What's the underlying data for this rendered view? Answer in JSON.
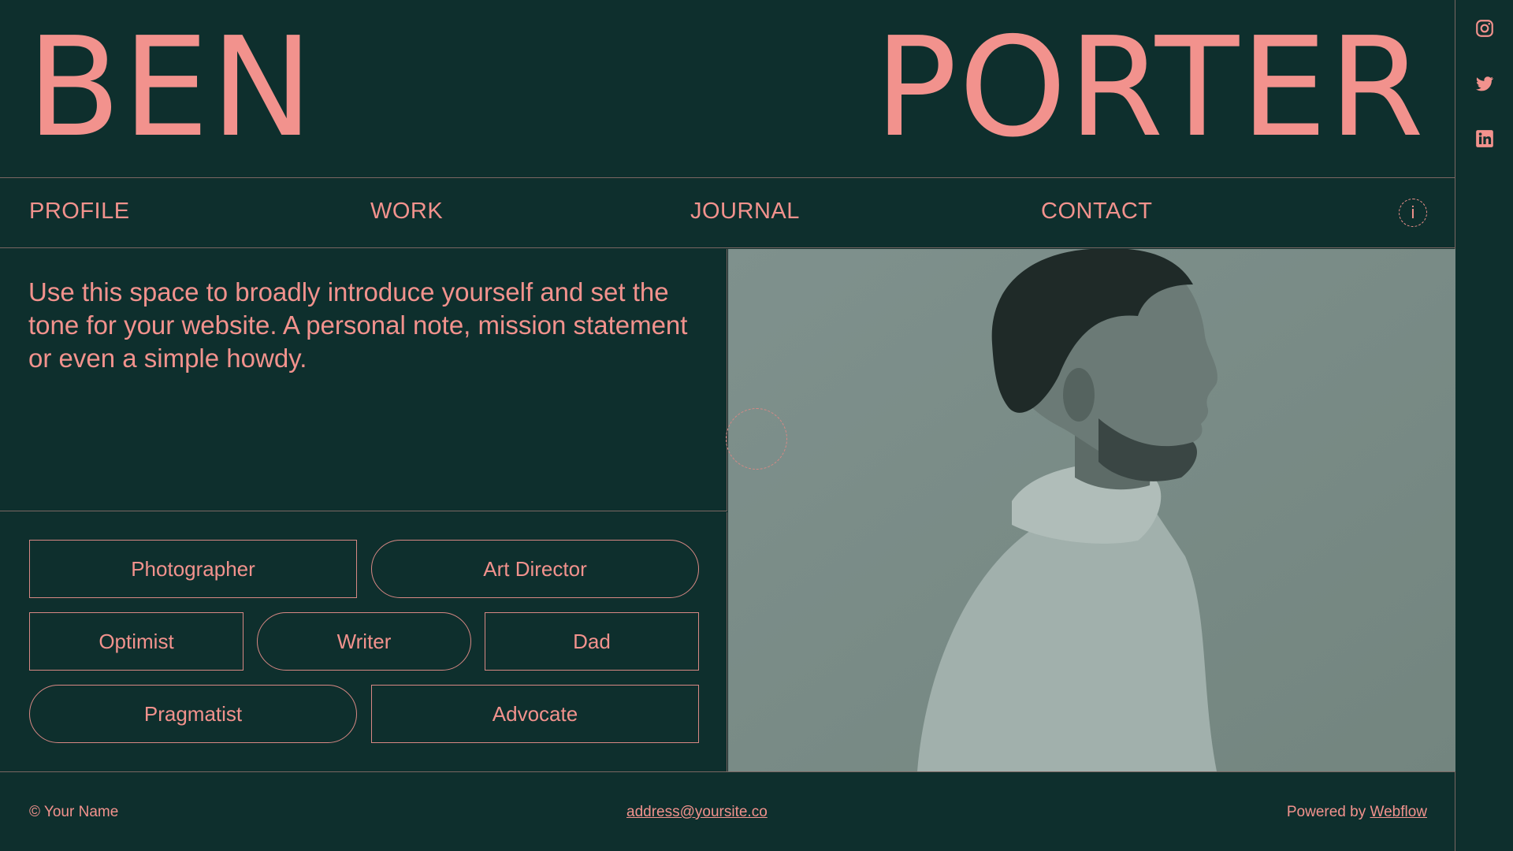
{
  "hero": {
    "first_name": "BEN",
    "last_name": "PORTER"
  },
  "nav": {
    "items": [
      {
        "label": "PROFILE"
      },
      {
        "label": "WORK"
      },
      {
        "label": "JOURNAL"
      },
      {
        "label": "CONTACT"
      }
    ],
    "info_glyph": "i"
  },
  "intro": {
    "text": "Use this space to broadly introduce yourself and set the tone for your website. A personal note, mission statement or even a simple howdy."
  },
  "tags": [
    {
      "label": "Photographer"
    },
    {
      "label": "Art Director"
    },
    {
      "label": "Optimist"
    },
    {
      "label": "Writer"
    },
    {
      "label": "Dad"
    },
    {
      "label": "Pragmatist"
    },
    {
      "label": "Advocate"
    }
  ],
  "footer": {
    "copyright": "© Your Name",
    "email": "address@yoursite.co",
    "powered_prefix": "Powered by ",
    "powered_link": "Webflow"
  },
  "social": [
    "instagram-icon",
    "twitter-icon",
    "linkedin-icon"
  ],
  "colors": {
    "background": "#0e2f2d",
    "accent": "#f2928d",
    "divider": "#7a6662",
    "photo_tint": "#7a8c88"
  }
}
